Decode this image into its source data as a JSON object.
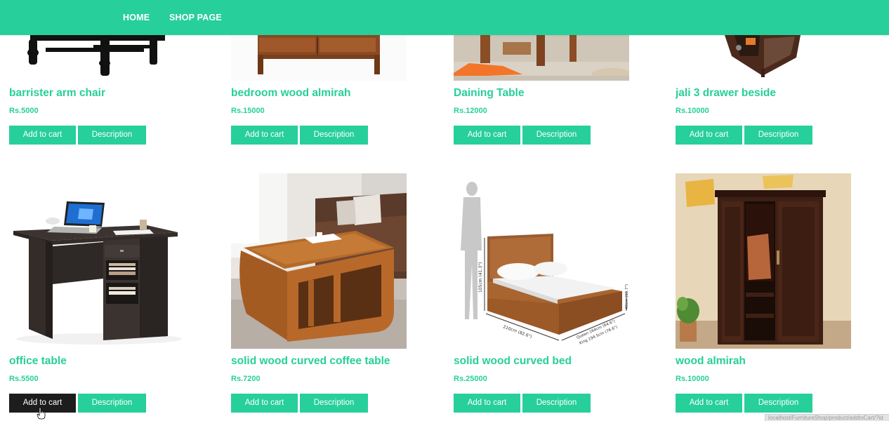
{
  "nav": {
    "home": "HOME",
    "shop": "SHOP PAGE",
    "bg_color": "#27cf9a"
  },
  "buttons": {
    "add_to_cart": "Add to cart",
    "description": "Description"
  },
  "products": [
    {
      "name": "barrister arm chair",
      "price": "Rs.5000"
    },
    {
      "name": "bedroom wood almirah",
      "price": "Rs.15000"
    },
    {
      "name": "Daining Table",
      "price": "Rs.12000"
    },
    {
      "name": "jali 3 drawer beside",
      "price": "Rs.10000"
    },
    {
      "name": "office table",
      "price": "Rs.5500"
    },
    {
      "name": "solid wood curved coffee table",
      "price": "Rs.7200"
    },
    {
      "name": "solid wood curved bed",
      "price": "Rs.25000"
    },
    {
      "name": "wood almirah",
      "price": "Rs.10000"
    }
  ],
  "bed_image_labels": {
    "height": "105cm (41.3\")",
    "length": "210cm (82.6\")",
    "width_right": "40cm (15.7\")",
    "queen": "Queen 164cm (64.6\")",
    "king": "King 194.5cm (76.6\")"
  },
  "status_tip": "localhost/FurnitureShop/product/addtoCart/?id"
}
